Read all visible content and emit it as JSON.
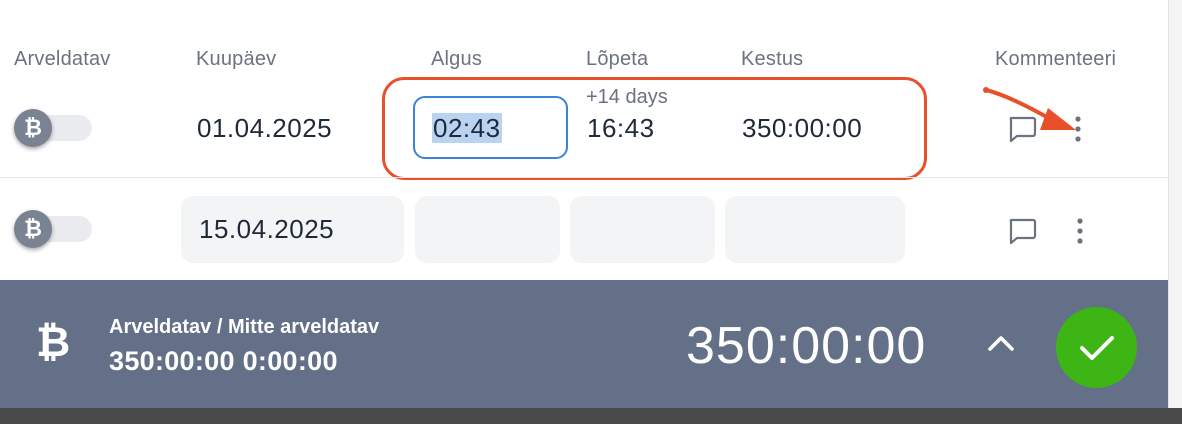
{
  "headers": {
    "billable": "Arveldatav",
    "date": "Kuupäev",
    "start": "Algus",
    "end": "Lõpeta",
    "duration": "Kestus",
    "comment": "Kommenteeri"
  },
  "rows": [
    {
      "date": "01.04.2025",
      "start": "02:43",
      "end_note": "+14 days",
      "end": "16:43",
      "duration": "350:00:00"
    },
    {
      "date": "15.04.2025",
      "start": "",
      "end": "",
      "duration": ""
    }
  ],
  "footer": {
    "title": "Arveldatav / Mitte arveldatav",
    "subtitle": "350:00:00 0:00:00",
    "total": "350:00:00"
  },
  "icons": {
    "billable": "bitcoin-icon",
    "comment": "comment-icon",
    "more": "more-vertical-icon",
    "expand": "chevron-up-icon",
    "confirm": "check-icon"
  },
  "colors": {
    "highlight": "#e8502a",
    "footer_bg": "#647087",
    "confirm_green": "#3cb515",
    "focus_blue": "#3a83d6"
  }
}
